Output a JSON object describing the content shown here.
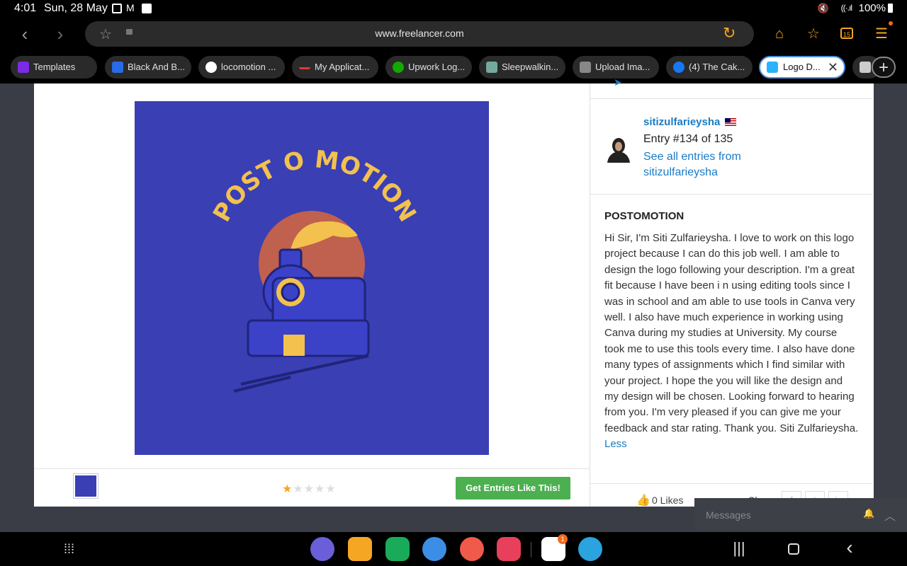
{
  "status_bar": {
    "time": "4:01",
    "date": "Sun, 28 May",
    "battery": "100%"
  },
  "browser": {
    "url": "www.freelancer.com",
    "tab_count": "15"
  },
  "tabs": [
    {
      "label": "Templates",
      "icon": "canva-icon",
      "color": "#7d2ae8"
    },
    {
      "label": "Black And B...",
      "icon": "canva-icon",
      "color": "#2a6ae8"
    },
    {
      "label": "locomotion ...",
      "icon": "google-icon",
      "color": "#4285f4"
    },
    {
      "label": "My Applicat...",
      "icon": "dash-icon",
      "color": "#e53935"
    },
    {
      "label": "Upwork Log...",
      "icon": "upwork-icon",
      "color": "#14a800"
    },
    {
      "label": "Sleepwalkin...",
      "icon": "chatgpt-icon",
      "color": "#74aa9c"
    },
    {
      "label": "Upload Ima...",
      "icon": "stack-icon",
      "color": "#888888"
    },
    {
      "label": "(4) The Cak...",
      "icon": "facebook-icon",
      "color": "#1877f2"
    },
    {
      "label": "Logo D...",
      "icon": "freelancer-icon",
      "color": "#29b2fe",
      "active": true
    }
  ],
  "entry": {
    "logo_text": "POST O MOTION",
    "username": "sitizulfarieysha",
    "entry_number": "Entry #134 of 135",
    "see_all": "See all entries from sitizulfarieysha",
    "title": "POSTOMOTION",
    "description": "Hi Sir, I'm Siti Zulfarieysha. I love to work on this logo project because I can do this job well. I am able to design the logo following your description. I'm a great fit because I have been i n using editing tools since I was in school and am able to use tools in Canva very well. I also have much experience in working using Canva during my studies at University. My course took me to use this tools every time. I also have done many types of assignments which I find similar with your project. I hope the you will like the design and my design will be chosen. Looking forward to hearing from you. I'm very pleased if you can give me your feedback and star rating. Thank you. Siti Zulfarieysha.",
    "less_link": "Less",
    "rating": 1,
    "rating_max": 5,
    "get_entries_button": "Get Entries Like This!",
    "likes": "0 Likes",
    "share_label": "Share:"
  },
  "messages_label": "Messages",
  "dock": {
    "gmail_badge": "1",
    "apps": [
      "internet-icon",
      "files-icon",
      "phone-icon",
      "messages-icon",
      "contacts-icon",
      "camera-icon",
      "gmail-icon",
      "telegram-icon"
    ]
  },
  "colors": {
    "logo_bg": "#3a3fb4",
    "logo_text": "#f2c14e",
    "sun": "#c0604e",
    "link": "#1a7bc4",
    "cta": "#4caf50",
    "star": "#f5a623"
  }
}
